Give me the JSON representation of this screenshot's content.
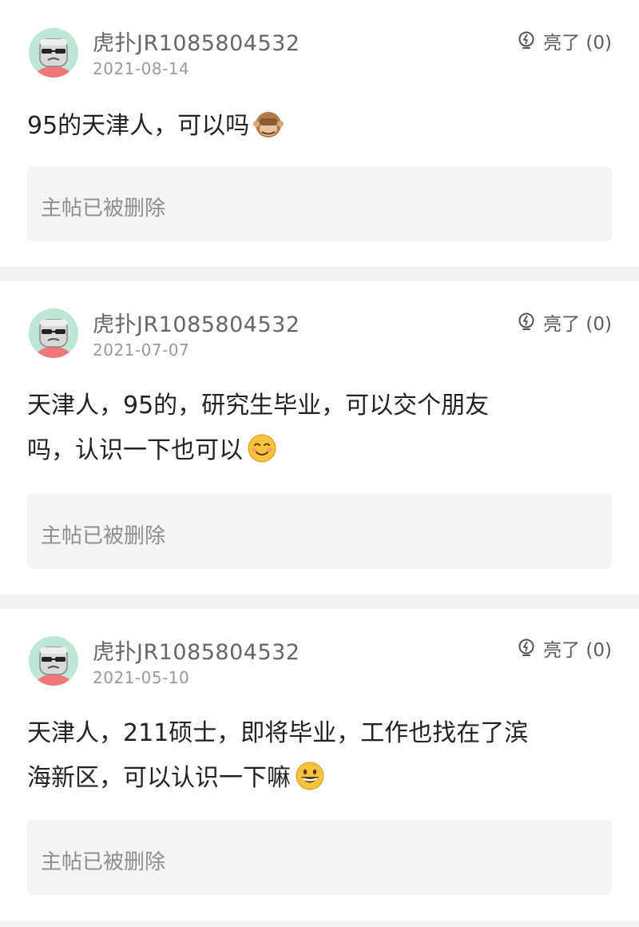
{
  "posts": [
    {
      "username": "虎扑JR1085804532",
      "date": "2021-08-14",
      "light_label": "亮了 (0)",
      "content_lines": [
        "95的天津人，可以吗"
      ],
      "emoji": "see-no-evil-monkey-icon",
      "deleted_text": "主帖已被删除"
    },
    {
      "username": "虎扑JR1085804532",
      "date": "2021-07-07",
      "light_label": "亮了 (0)",
      "content_lines": [
        "天津人，95的，研究生毕业，可以交个朋友",
        "吗，认识一下也可以"
      ],
      "emoji": "smiling-face-icon",
      "deleted_text": "主帖已被删除"
    },
    {
      "username": "虎扑JR1085804532",
      "date": "2021-05-10",
      "light_label": "亮了 (0)",
      "content_lines": [
        "天津人，211硕士，即将毕业，工作也找在了滨",
        "海新区，可以认识一下嘛"
      ],
      "emoji": "grinning-face-icon",
      "deleted_text": "主帖已被删除"
    }
  ],
  "colors": {
    "page_bg": "#f2f2f4",
    "card_bg": "#ffffff",
    "deleted_bg": "#f4f4f6",
    "avatar_bg": "#bfe6d4"
  }
}
